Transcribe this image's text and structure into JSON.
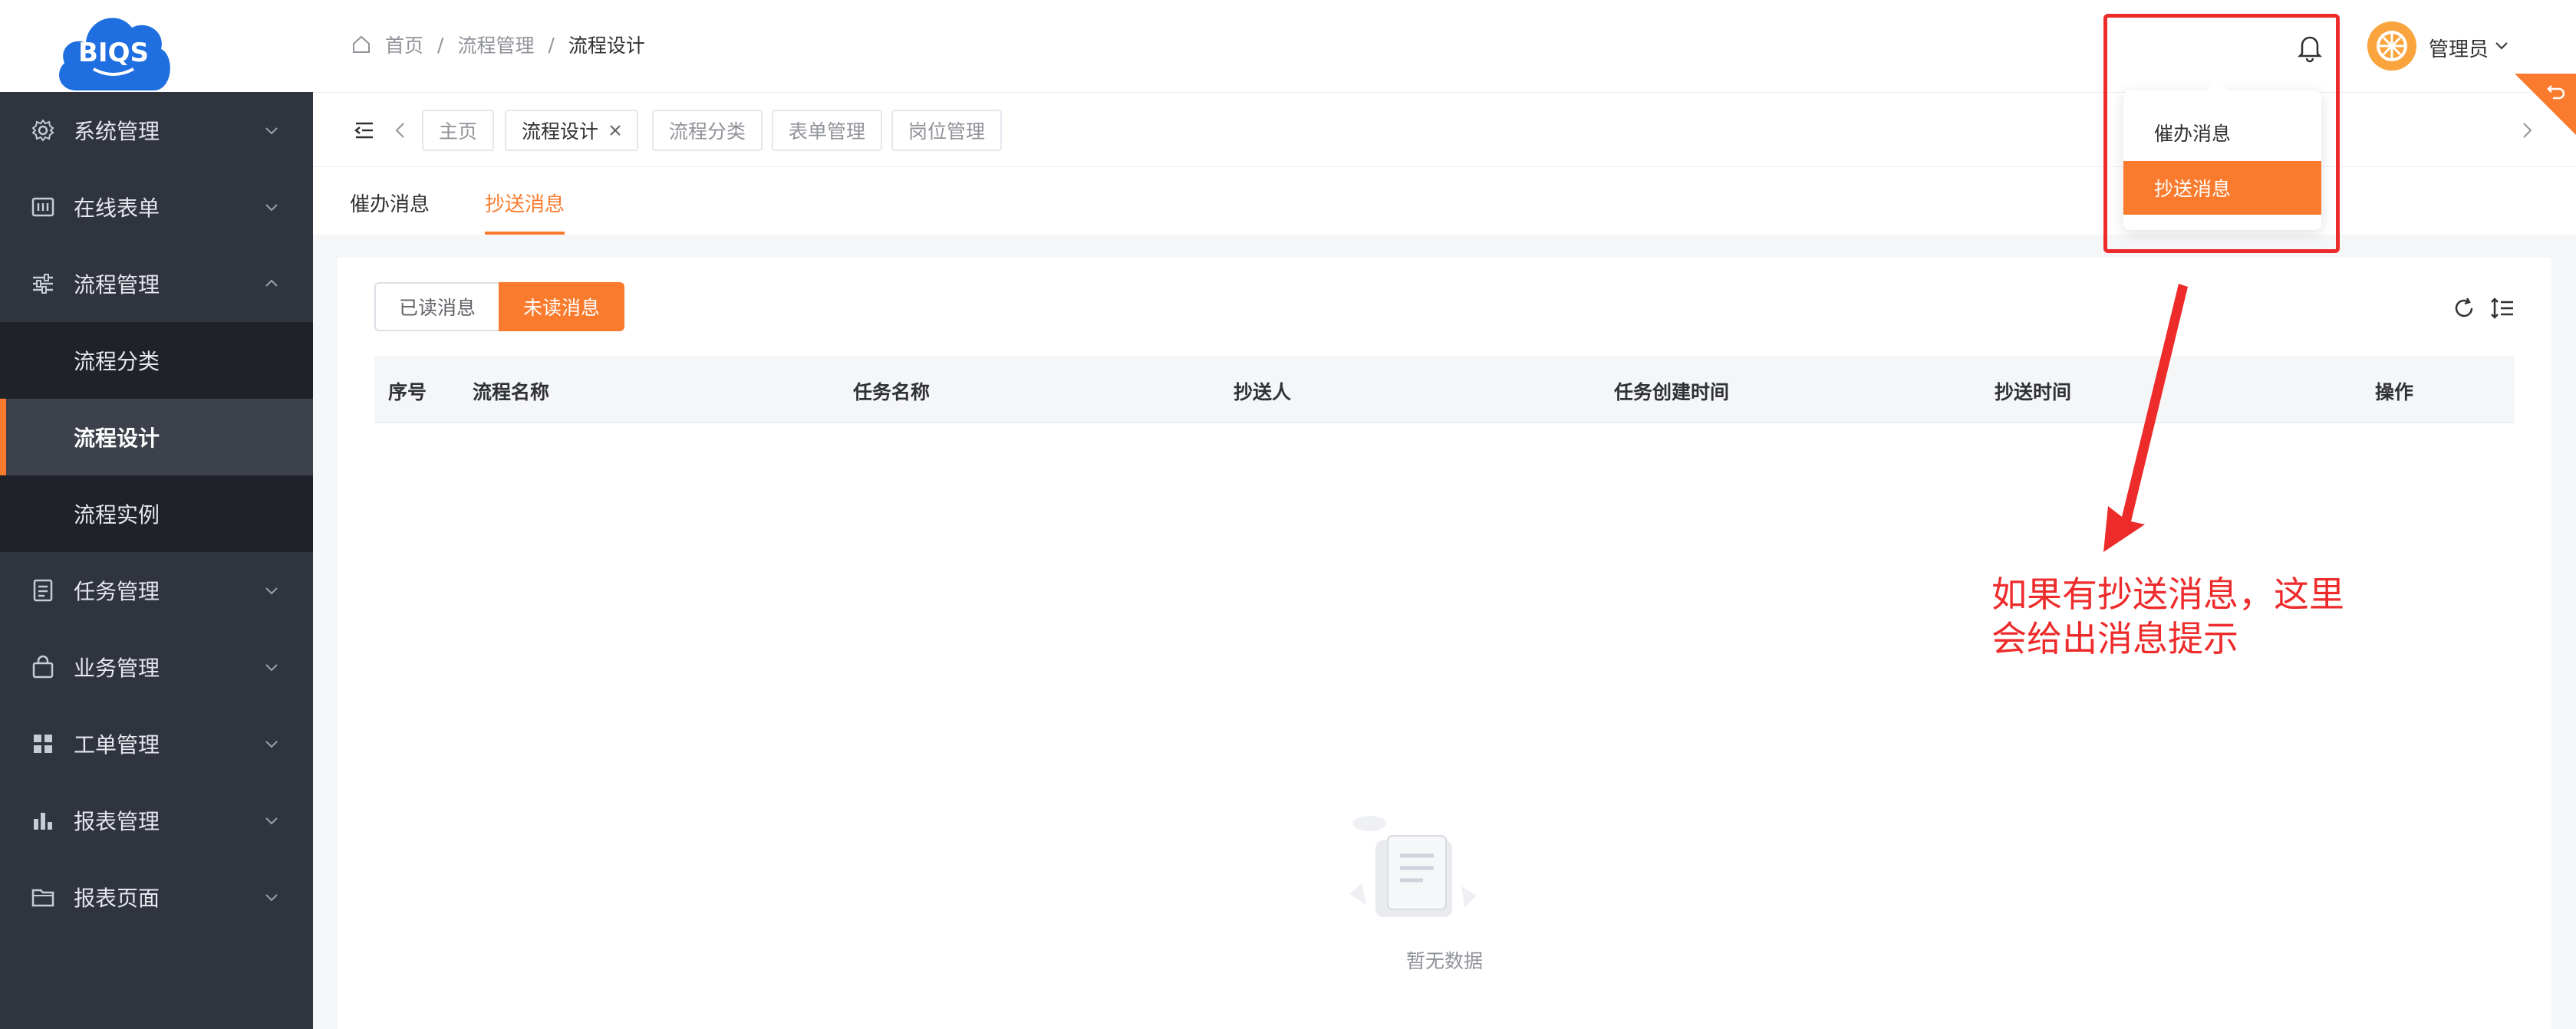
{
  "logo": {
    "text": "BIQS"
  },
  "breadcrumb": {
    "home": "首页",
    "sep": "/",
    "level1": "流程管理",
    "current": "流程设计"
  },
  "header": {
    "user": "管理员"
  },
  "sidebar": {
    "items": [
      {
        "label": "系统管理",
        "icon": "gear-icon"
      },
      {
        "label": "在线表单",
        "icon": "form-icon"
      },
      {
        "label": "流程管理",
        "icon": "sliders-icon"
      },
      {
        "label": "任务管理",
        "icon": "doc-icon"
      },
      {
        "label": "业务管理",
        "icon": "bag-icon"
      },
      {
        "label": "工单管理",
        "icon": "grid-icon"
      },
      {
        "label": "报表管理",
        "icon": "bar-chart-icon"
      },
      {
        "label": "报表页面",
        "icon": "folder-icon"
      }
    ],
    "sub": [
      {
        "label": "流程分类"
      },
      {
        "label": "流程设计",
        "active": true
      },
      {
        "label": "流程实例"
      }
    ]
  },
  "tags": [
    {
      "label": "主页"
    },
    {
      "label": "流程设计",
      "active": true
    },
    {
      "label": "流程分类"
    },
    {
      "label": "表单管理"
    },
    {
      "label": "岗位管理"
    }
  ],
  "tabs": {
    "urge": "催办消息",
    "cc": "抄送消息"
  },
  "segment": {
    "read": "已读消息",
    "unread": "未读消息"
  },
  "table": {
    "headers": [
      "序号",
      "流程名称",
      "任务名称",
      "抄送人",
      "任务创建时间",
      "抄送时间",
      "操作"
    ],
    "rows": []
  },
  "empty": {
    "text": "暂无数据"
  },
  "dropdown": {
    "items": [
      "催办消息",
      "抄送消息"
    ]
  },
  "annotation": {
    "line1": "如果有抄送消息，这里",
    "line2": "会给出消息提示"
  },
  "colors": {
    "accent": "#fa7b2d",
    "sidebar": "#30343f",
    "annotation": "#ee2b2b"
  }
}
